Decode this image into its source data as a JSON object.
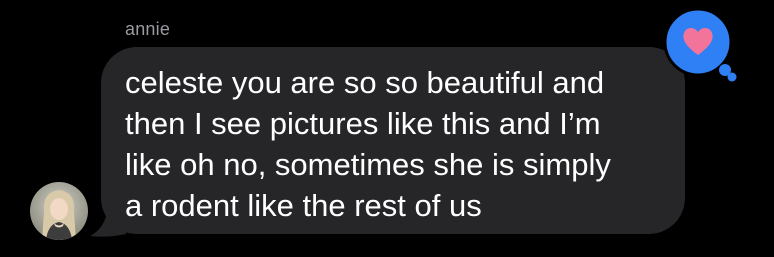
{
  "message": {
    "sender": "annie",
    "text": "celeste you are so so beautiful and\nthen I see pictures like this and I’m\nlike oh no, sometimes she is simply\na rodent like the rest of us",
    "bubble_color": "#262629",
    "text_color": "#ffffff"
  },
  "reaction": {
    "icon": "heart-icon",
    "badge_color": "#2f7ff5",
    "heart_color": "#f2749a"
  },
  "avatar": {
    "icon": "user-avatar-photo"
  }
}
